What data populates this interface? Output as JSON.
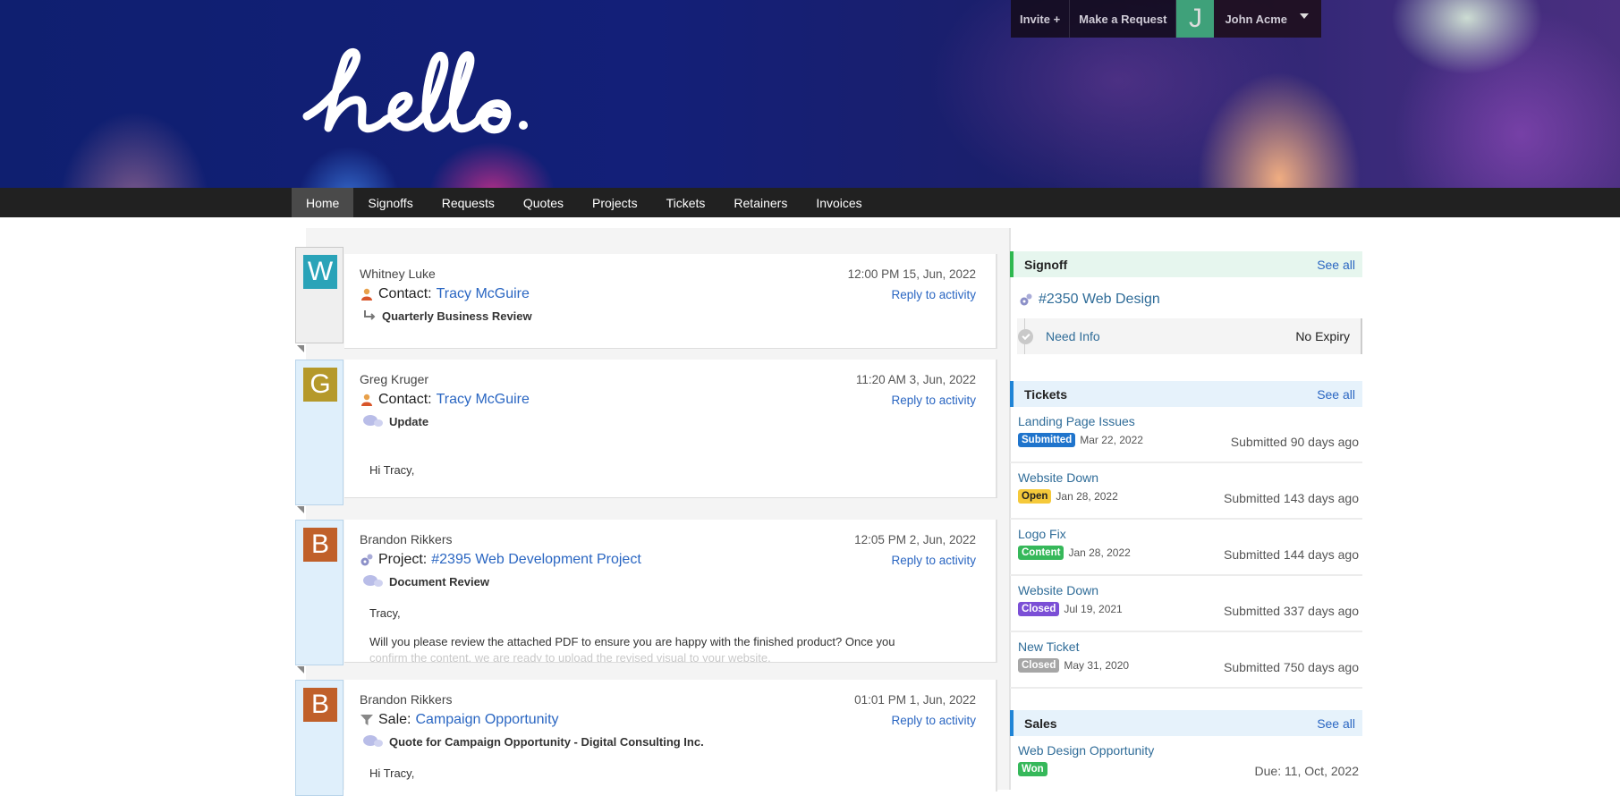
{
  "header": {
    "logo_text": "hello.",
    "topbar": {
      "invite_label": "Invite +",
      "request_label": "Make a Request",
      "avatar_initial": "J",
      "user_name": "John Acme"
    }
  },
  "nav": {
    "items": [
      {
        "label": "Home",
        "active": true
      },
      {
        "label": "Signoffs"
      },
      {
        "label": "Requests"
      },
      {
        "label": "Quotes"
      },
      {
        "label": "Projects"
      },
      {
        "label": "Tickets"
      },
      {
        "label": "Retainers"
      },
      {
        "label": "Invoices"
      }
    ]
  },
  "feed": [
    {
      "initial": "W",
      "avatar_color": "#2aa3b8",
      "author": "Whitney Luke",
      "timestamp": "12:00 PM 15, Jun, 2022",
      "reply_label": "Reply to activity",
      "related_type": "Contact:",
      "related_name": "Tracy McGuire",
      "related_icon": "contact-icon",
      "subject": "Quarterly Business Review",
      "subject_icon": "reply-arrow-icon",
      "lines": []
    },
    {
      "initial": "G",
      "avatar_color": "#b5992b",
      "author": "Greg Kruger",
      "timestamp": "11:20 AM 3, Jun, 2022",
      "reply_label": "Reply to activity",
      "related_type": "Contact:",
      "related_name": "Tracy McGuire",
      "related_icon": "contact-icon",
      "subject": "Update",
      "subject_icon": "chat-bubbles-icon",
      "lines": [
        "Hi Tracy,"
      ]
    },
    {
      "initial": "B",
      "avatar_color": "#c0602a",
      "author": "Brandon Rikkers",
      "timestamp": "12:05 PM 2, Jun, 2022",
      "reply_label": "Reply to activity",
      "related_type": "Project:",
      "related_name": "#2395 Web Development Project",
      "related_icon": "gears-icon",
      "subject": "Document Review",
      "subject_icon": "chat-bubbles-icon",
      "lines": [
        "Tracy,",
        "Will you please review the attached PDF to ensure you are happy with the finished product? Once you",
        "confirm the content, we are ready to upload the revised visual to your website."
      ]
    },
    {
      "initial": "B",
      "avatar_color": "#c0602a",
      "author": "Brandon Rikkers",
      "timestamp": "01:01 PM 1, Jun, 2022",
      "reply_label": "Reply to activity",
      "related_type": "Sale:",
      "related_name": "Campaign Opportunity",
      "related_icon": "funnel-icon",
      "subject": "Quote for Campaign Opportunity - Digital Consulting Inc.",
      "subject_icon": "chat-bubbles-icon",
      "lines": [
        "Hi Tracy,"
      ]
    }
  ],
  "sidebar": {
    "signoff": {
      "title": "Signoff",
      "see_all": "See all",
      "item_title": "#2350 Web Design",
      "status": "Need Info",
      "expiry": "No Expiry"
    },
    "tickets": {
      "title": "Tickets",
      "see_all": "See all",
      "items": [
        {
          "name": "Landing Page Issues",
          "status": "Submitted",
          "status_color": "#1f74cc",
          "status_text_color": "#ffffff",
          "date": "Mar 22, 2022",
          "age": "Submitted 90 days ago"
        },
        {
          "name": "Website Down",
          "status": "Open",
          "status_color": "#f5c93a",
          "status_text_color": "#222222",
          "date": "Jan 28, 2022",
          "age": "Submitted 143 days ago"
        },
        {
          "name": "Logo Fix",
          "status": "Content",
          "status_color": "#36b85a",
          "status_text_color": "#ffffff",
          "date": "Jan 28, 2022",
          "age": "Submitted 144 days ago"
        },
        {
          "name": "Website Down",
          "status": "Closed",
          "status_color": "#7b4fd6",
          "status_text_color": "#ffffff",
          "date": "Jul 19, 2021",
          "age": "Submitted 337 days ago"
        },
        {
          "name": "New Ticket",
          "status": "Closed",
          "status_color": "#a6a6a6",
          "status_text_color": "#ffffff",
          "date": "May 31, 2020",
          "age": "Submitted 750 days ago"
        }
      ]
    },
    "sales": {
      "title": "Sales",
      "see_all": "See all",
      "items": [
        {
          "name": "Web Design Opportunity",
          "status": "Won",
          "status_color": "#36b85a",
          "status_text_color": "#ffffff",
          "due": "Due: 11, Oct, 2022"
        }
      ]
    }
  }
}
